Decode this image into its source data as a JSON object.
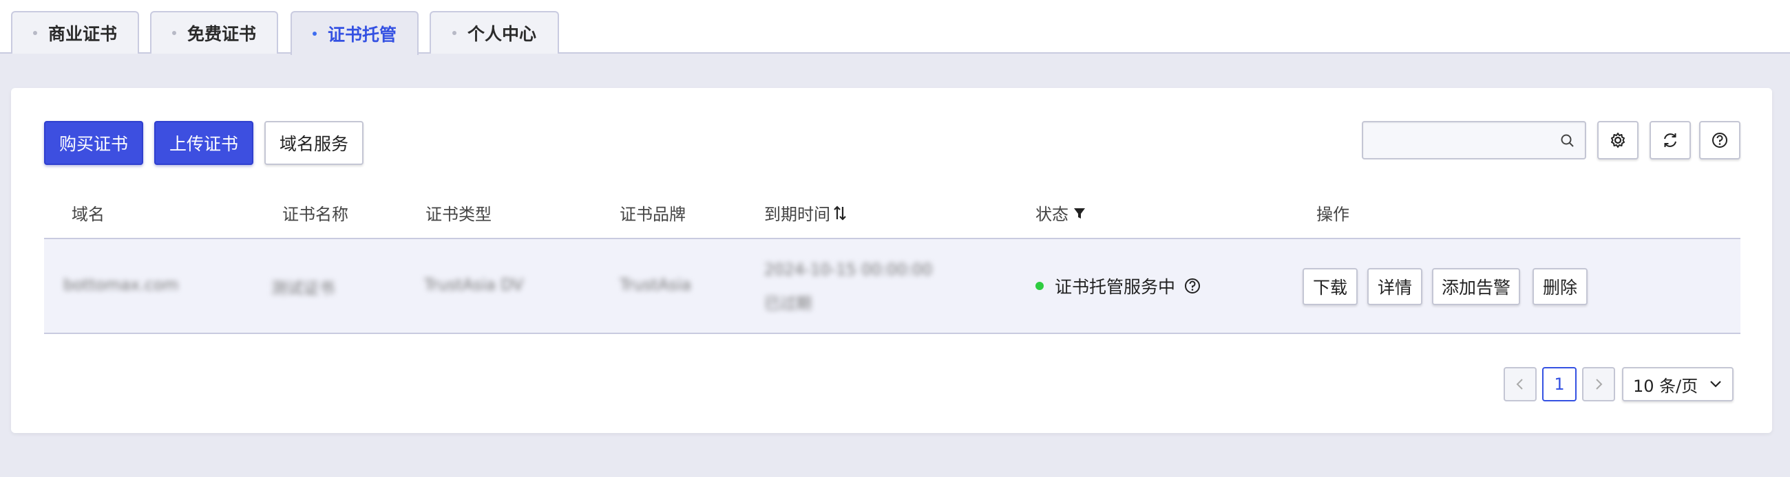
{
  "tabs": [
    {
      "label": "商业证书"
    },
    {
      "label": "免费证书"
    },
    {
      "label": "证书托管"
    },
    {
      "label": "个人中心"
    }
  ],
  "toolbar": {
    "buy_label": "购买证书",
    "upload_label": "上传证书",
    "domain_label": "域名服务",
    "search_placeholder": ""
  },
  "table": {
    "columns": {
      "domain": "域名",
      "cert_name": "证书名称",
      "cert_type": "证书类型",
      "cert_brand": "证书品牌",
      "expiry": "到期时间",
      "status": "状态",
      "actions": "操作"
    },
    "rows": [
      {
        "domain": "bottomax.com",
        "cert_name": "测试证书",
        "cert_type": "TrustAsia DV",
        "cert_brand": "TrustAsia",
        "expiry_line1": "2024-10-15 00:00:00",
        "expiry_line2": "已过期",
        "status": "证书托管服务中",
        "status_color": "#2ecc40",
        "actions": {
          "download": "下载",
          "detail": "详情",
          "add_alert": "添加告警",
          "delete": "删除"
        }
      }
    ]
  },
  "pagination": {
    "current_page": "1",
    "page_size": "10 条/页"
  },
  "colors": {
    "accent": "#3d4fe0",
    "active_tab_text": "#3451e2"
  }
}
